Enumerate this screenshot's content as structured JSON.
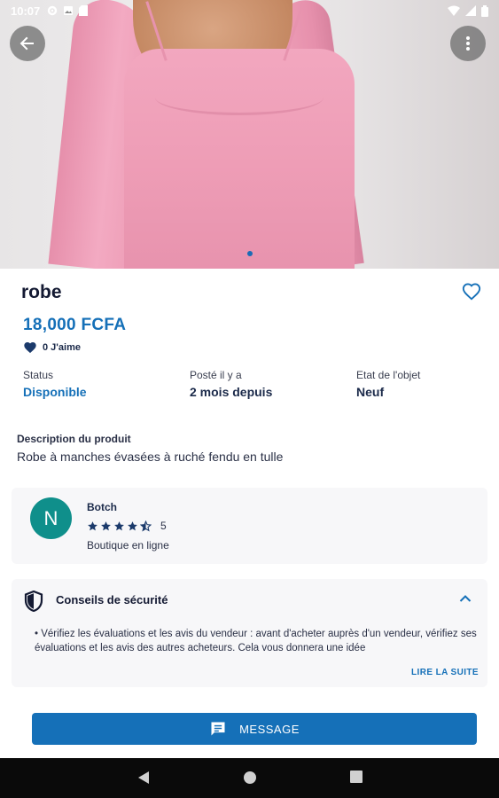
{
  "status_bar": {
    "time": "10:07"
  },
  "product": {
    "title": "robe",
    "price": "18,000 FCFA",
    "likes": "0 J'aime",
    "image_index": 1,
    "image_count": 1
  },
  "meta": {
    "status_label": "Status",
    "status_value": "Disponible",
    "posted_label": "Posté il y a",
    "posted_value": "2 mois depuis",
    "state_label": "Etat de l'objet",
    "state_value": "Neuf"
  },
  "description": {
    "label": "Description du produit",
    "text": "Robe à manches évasées à ruché fendu en tulle"
  },
  "seller": {
    "initial": "N",
    "name": "Botch",
    "rating": "5",
    "rating_stars": 4.5,
    "type": "Boutique en ligne"
  },
  "safety": {
    "title": "Conseils de sécurité",
    "text": "• Vérifiez les évaluations et les avis du vendeur : avant d'acheter auprès d'un vendeur, vérifiez ses évaluations et les avis des autres acheteurs. Cela vous donnera une idée",
    "read_more": "LIRE LA SUITE"
  },
  "actions": {
    "message_label": "MESSAGE"
  },
  "colors": {
    "accent": "#1570b8",
    "avatar": "#0f8f8b",
    "card_bg": "#f7f7f9"
  }
}
